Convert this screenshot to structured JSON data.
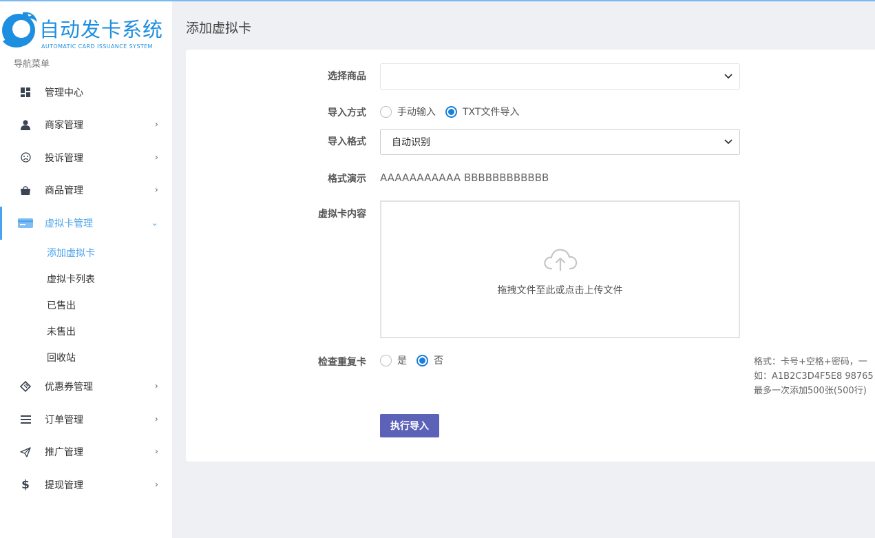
{
  "brand": {
    "title": "自动发卡系统",
    "subtitle": "AUTOMATIC CARD ISSUANCE SYSTEM",
    "color": "#1e8fe0"
  },
  "sidebar": {
    "caption": "导航菜单",
    "items": [
      {
        "label": "管理中心",
        "icon": "dashboard-icon",
        "arrow": ""
      },
      {
        "label": "商家管理",
        "icon": "user-icon",
        "arrow": "›"
      },
      {
        "label": "投诉管理",
        "icon": "sad-face-icon",
        "arrow": "›"
      },
      {
        "label": "商品管理",
        "icon": "shopping-bag-icon",
        "arrow": "›"
      },
      {
        "label": "虚拟卡管理",
        "icon": "card-icon",
        "arrow": "⌄"
      },
      {
        "label": "优惠券管理",
        "icon": "ticket-icon",
        "arrow": "›"
      },
      {
        "label": "订单管理",
        "icon": "list-icon",
        "arrow": "›"
      },
      {
        "label": "推广管理",
        "icon": "paper-plane-icon",
        "arrow": "›"
      },
      {
        "label": "提现管理",
        "icon": "dollar-icon",
        "arrow": "›"
      }
    ],
    "sub_items": [
      "添加虚拟卡",
      "虚拟卡列表",
      "已售出",
      "未售出",
      "回收站"
    ],
    "active_color": "#4aa3ee"
  },
  "page": {
    "title": "添加虚拟卡"
  },
  "form": {
    "product_label": "选择商品",
    "product_value": "",
    "import_method_label": "导入方式",
    "import_methods": [
      {
        "label": "手动输入",
        "checked": false
      },
      {
        "label": "TXT文件导入",
        "checked": true
      }
    ],
    "import_format_label": "导入格式",
    "import_format_value": "自动识别",
    "demo_label": "格式演示",
    "demo_value": "AAAAAAAAAAA BBBBBBBBBBBB",
    "content_label": "虚拟卡内容",
    "upload_text": "拖拽文件至此或点击上传文件",
    "check_dup_label": "检查重复卡",
    "check_dup_options": [
      {
        "label": "是",
        "checked": false
      },
      {
        "label": "否",
        "checked": true
      }
    ],
    "hint_lines": [
      "格式：卡号+空格+密码，一",
      "如：A1B2C3D4F5E8 98765",
      "最多一次添加500张(500行)"
    ],
    "submit_label": "执行导入",
    "submit_color": "#5b62b8"
  }
}
